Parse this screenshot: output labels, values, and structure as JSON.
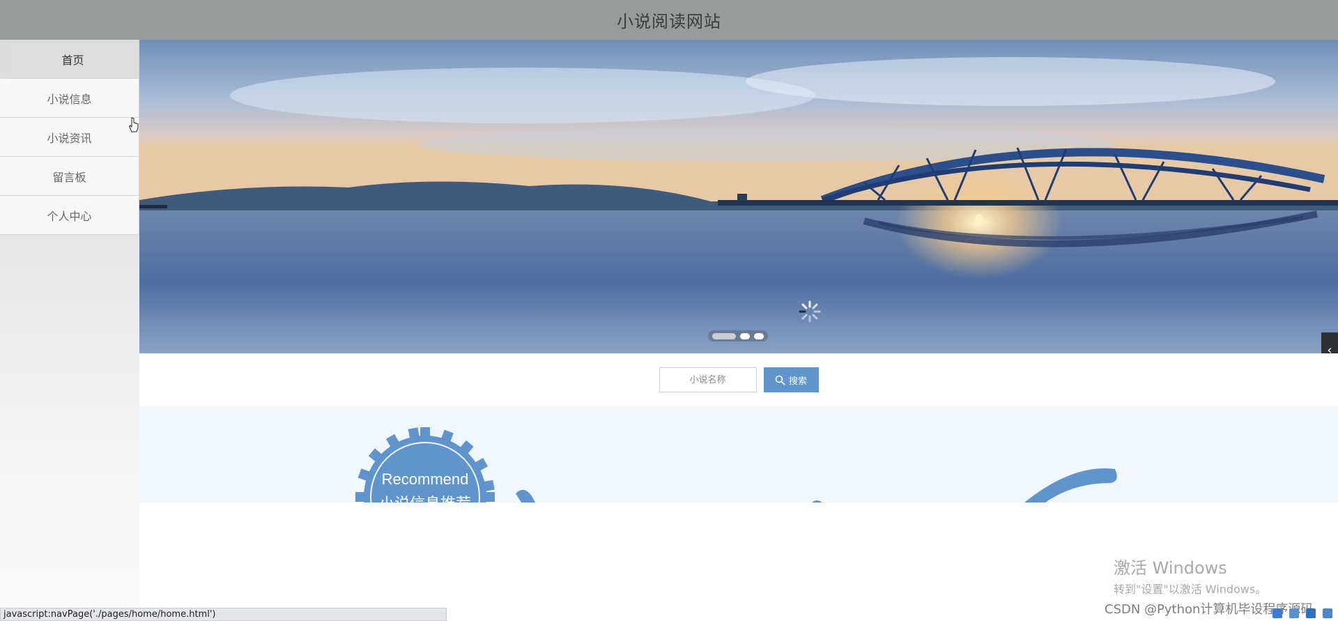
{
  "header": {
    "title": "小说阅读网站"
  },
  "nav": {
    "items": [
      {
        "label": "首页",
        "active": true
      },
      {
        "label": "小说信息"
      },
      {
        "label": "小说资讯"
      },
      {
        "label": "留言板"
      },
      {
        "label": "个人中心"
      }
    ]
  },
  "banner": {
    "slide_count": 3,
    "active_slide": 1
  },
  "search": {
    "placeholder": "小说名称",
    "button_label": "搜索"
  },
  "recommend": {
    "title_en": "Recommend",
    "title_cn": "小说信息推荐"
  },
  "status_bar": {
    "url": "javascript:navPage('./pages/home/home.html')"
  },
  "os_watermark": {
    "line1": "激活 Windows",
    "line2": "转到\"设置\"以激活 Windows。"
  },
  "credit": {
    "text": "CSDN @Python计算机毕设程序源码"
  },
  "colors": {
    "accent": "#5f94cd",
    "header_bg": "#979b9c",
    "recommend_bg": "#eff6fc"
  }
}
